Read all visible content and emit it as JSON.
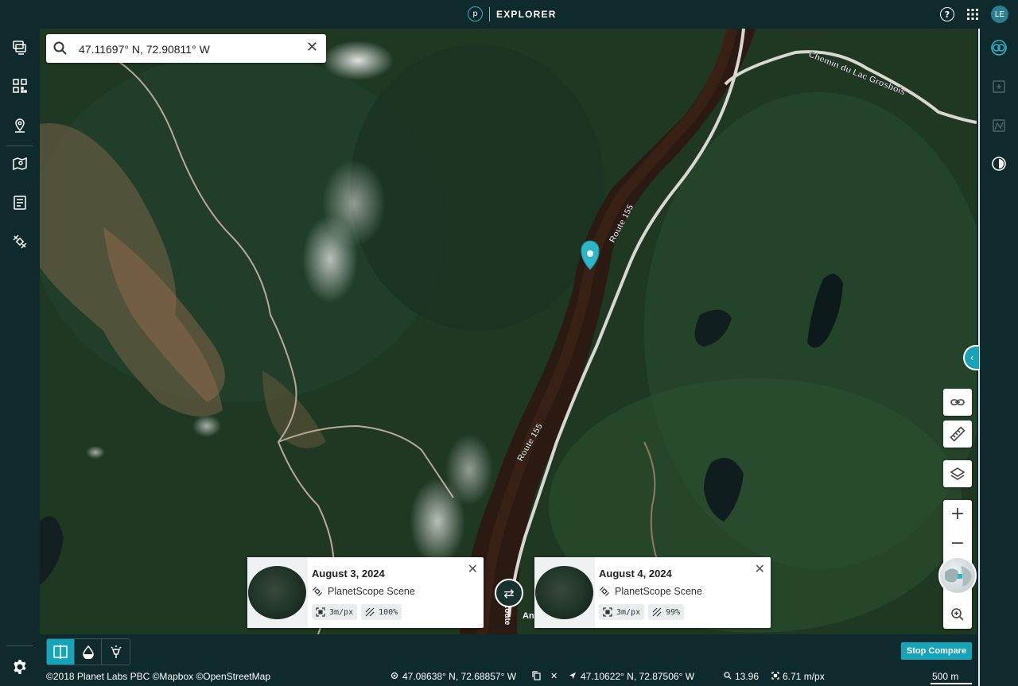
{
  "app": {
    "title": "EXPLORER",
    "user_initials": "LE"
  },
  "search": {
    "value": "47.11697° N, 72.90811° W"
  },
  "map": {
    "labels": {
      "road_1": "Route 155",
      "road_2": "Route 155",
      "road_3": "Chemin du Lac Grosbois",
      "road_4": "Route",
      "place_partial": "An"
    }
  },
  "compare": {
    "left": {
      "date": "August 3, 2024",
      "source": "PlanetScope Scene",
      "resolution": "3m/px",
      "coverage": "100%"
    },
    "right": {
      "date": "August 4, 2024",
      "source": "PlanetScope Scene",
      "resolution": "3m/px",
      "coverage": "99%"
    },
    "stop_label": "Stop Compare"
  },
  "status": {
    "attribution": "©2018 Planet Labs PBC ©Mapbox ©OpenStreetMap",
    "cursor_coords": "47.08638° N, 72.68857° W",
    "pin_coords": "47.10622° N, 72.87506° W",
    "zoom": "13.96",
    "resolution": "6.71 m/px",
    "scale": "500 m"
  },
  "colors": {
    "accent": "#17a3b8",
    "chrome": "#0f2a2d"
  },
  "icons": {
    "left_rail": [
      "layers-stack-icon",
      "qr-grid-icon",
      "location-pin-icon",
      "map-photo-icon",
      "document-list-icon",
      "satellite-icon",
      "settings-gear-icon"
    ],
    "right_rail": [
      "compare-icon",
      "add-image-icon",
      "chart-icon",
      "brightness-icon"
    ]
  }
}
